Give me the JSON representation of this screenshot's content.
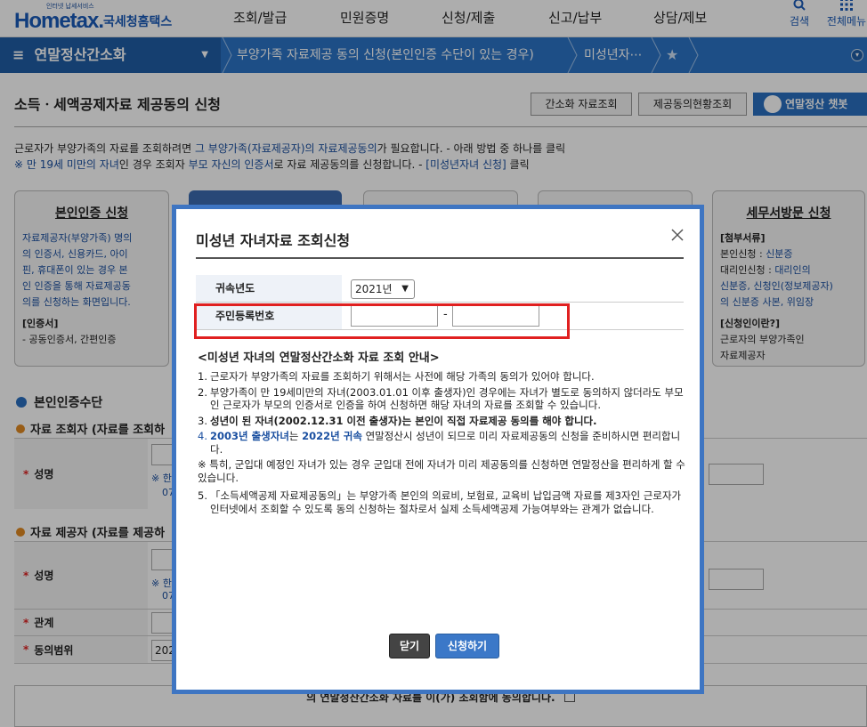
{
  "header": {
    "logo_sub": "인터넷 납세서비스",
    "logo_main": "Hometax.",
    "logo_kr": "국세청홈택스",
    "nav": [
      "조회/발급",
      "민원증명",
      "신청/제출",
      "신고/납부",
      "상담/제보"
    ],
    "search_label": "검색",
    "menu_label": "전체메뉴"
  },
  "breadcrumb": {
    "main": "연말정산간소화",
    "item1": "부양가족 자료제공 동의 신청(본인인증 수단이 있는 경우)",
    "item2": "미성년자⋯"
  },
  "page": {
    "title": "소득ㆍ세액공제자료 제공동의 신청",
    "btn_query": "간소화 자료조회",
    "btn_status": "제공동의현황조회",
    "btn_chatbot": "연말정산 챗봇",
    "desc_line1_a": "근로자가 부양가족의 자료를 조회하려면 ",
    "desc_line1_b": "그 부양가족(자료제공자)의 자료제공동의",
    "desc_line1_c": "가 필요합니다. - 아래 방법 중 하나를 클릭",
    "desc_line2_a": "※ 만 19세 미만의 자녀",
    "desc_line2_b": "인 경우 조회자 ",
    "desc_line2_c": "부모 자신의 인증서",
    "desc_line2_d": "로 자료 제공동의를 신청합니다. - ",
    "desc_line2_e": "[미성년자녀 신청]",
    "desc_line2_f": " 클릭"
  },
  "cards": {
    "self_title": "본인인증 신청",
    "self_l1": "자료제공자(부양가족) 명의",
    "self_l2": "의 인증서, 신용카드, 아이",
    "self_l3": "핀, 휴대폰이 있는 경우 본",
    "self_l4": "인 인증을 통해 자료제공동",
    "self_l5": "의를 신청하는 화면입니다.",
    "self_l6": "[인증서]",
    "self_l7": "- 공동인증서, 간편인증",
    "tax_title": "세무서방문 신청",
    "tax_l1": "[첨부서류]",
    "tax_l2a": "본인신청 : ",
    "tax_l2b": "신분증",
    "tax_l3a": "대리인신청 : ",
    "tax_l3b": "대리인의",
    "tax_l4": "신분증, 신청인(정보제공자)",
    "tax_l5": "의 신분증 사본, 위임장",
    "tax_l6": "[신청인이란?]",
    "tax_l7": "근로자의 부양가족인",
    "tax_l8": "자료제공자"
  },
  "form": {
    "section_title": "본인인증수단",
    "sub1": "자료 조회자 (자료를 조회하",
    "sub2": "자료 제공자 (자료를 제공하",
    "name_label": "성명",
    "relation_label": "관계",
    "range_label": "동의범위",
    "range_value": "202",
    "hint1": "※ 한",
    "hint1b": "07",
    "hint2": "※ 한",
    "hint2b": "07",
    "agree_text": "의 연말정산간소화 자료를 이(가) 조회함에 동의합니다."
  },
  "modal": {
    "title": "미성년 자녀자료 조회신청",
    "year_label": "귀속년도",
    "year_value": "2021년",
    "rrn_label": "주민등록번호",
    "rrn_dash": "-",
    "guide_title": "<미성년 자녀의 연말정산간소화 자료 조회 안내>",
    "g1": "근로자가 부양가족의 자료를 조회하기 위해서는 사전에 해당 가족의 동의가 있어야 합니다.",
    "g2": "부양가족이 만 19세미만의 자녀(2003.01.01 이후 출생자)인 경우에는 자녀가 별도로 동의하지 않더라도 부모인 근로자가 부모의 인증서로 인증을 하여 신청하면 해당 자녀의 자료를 조회할 수 있습니다.",
    "g3": "성년이 된 자녀(2002.12.31 이전 출생자)는 본인이 직접 자료제공 동의를 해야 합니다.",
    "g4a": "2003년 출생자녀",
    "g4b": "는 ",
    "g4c": "2022년 귀속",
    "g4d": " 연말정산시 성년이 되므로 미리 자료제공동의 신청을 준비하시면 편리합니다.",
    "g5": "※ 특히, 군입대 예정인 자녀가 있는 경우 군입대 전에 자녀가 미리 제공동의를 신청하면 연말정산을 편리하게 할 수 있습니다.",
    "g6": "「소득세액공제 자료제공동의」는 부양가족 본인의 의료비, 보험료, 교육비 납입금액 자료를 제3자인 근로자가 인터넷에서 조회할 수 있도록 동의 신청하는 절차로서 실제 소득세액공제 가능여부와는 관계가 없습니다.",
    "n1": "1.",
    "n2": "2.",
    "n3": "3.",
    "n4": "4.",
    "n5": "5.",
    "close_btn": "닫기",
    "apply_btn": "신청하기"
  },
  "colors": {
    "brand": "#1a5bb8",
    "bar": "#2b74c6",
    "modal_border": "#3e75c2",
    "highlight": "#e02020"
  }
}
